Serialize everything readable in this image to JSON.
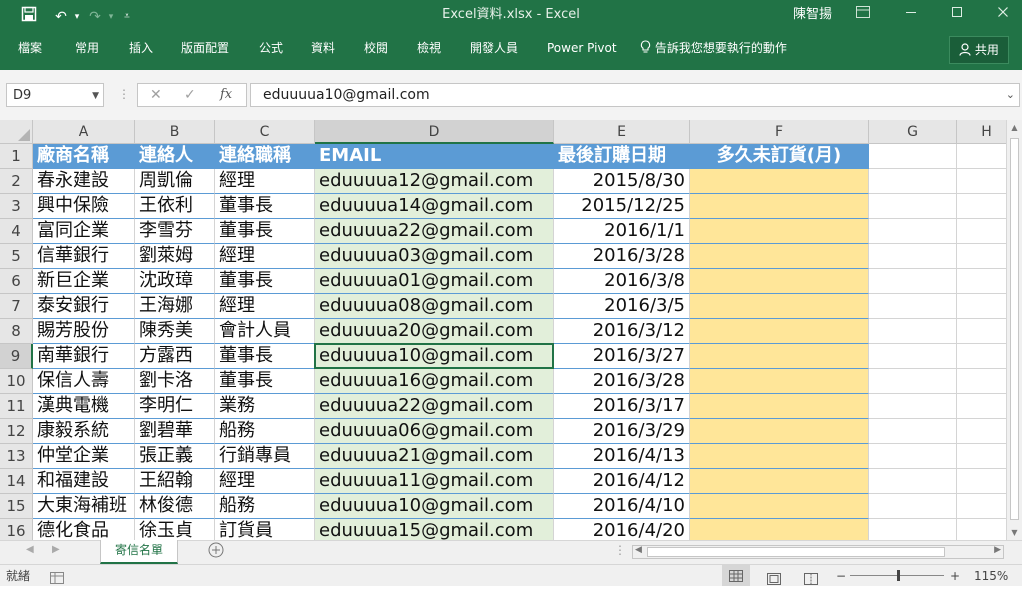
{
  "window": {
    "title": "Excel資料.xlsx - Excel",
    "user": "陳智揚"
  },
  "ribbon": {
    "tabs": [
      "檔案",
      "常用",
      "插入",
      "版面配置",
      "公式",
      "資料",
      "校閱",
      "檢視",
      "開發人員",
      "Power Pivot"
    ],
    "tell_me": "告訴我您想要執行的動作",
    "share": "共用"
  },
  "formula_bar": {
    "name_box": "D9",
    "fx": "fx",
    "value": "eduuuua10@gmail.com"
  },
  "columns": [
    "A",
    "B",
    "C",
    "D",
    "E",
    "F",
    "G",
    "H"
  ],
  "rows": [
    1,
    2,
    3,
    4,
    5,
    6,
    7,
    8,
    9,
    10,
    11,
    12,
    13,
    14,
    15,
    16
  ],
  "header_row": [
    "廠商名稱",
    "連絡人",
    "連絡職稱",
    "EMAIL",
    "最後訂購日期",
    "多久未訂貨(月)"
  ],
  "data": [
    [
      "春永建設",
      "周凱倫",
      "經理",
      "eduuuua12@gmail.com",
      "2015/8/30",
      ""
    ],
    [
      "興中保險",
      "王依利",
      "董事長",
      "eduuuua14@gmail.com",
      "2015/12/25",
      ""
    ],
    [
      "富同企業",
      "李雪芬",
      "董事長",
      "eduuuua22@gmail.com",
      "2016/1/1",
      ""
    ],
    [
      "信華銀行",
      "劉萊姆",
      "經理",
      "eduuuua03@gmail.com",
      "2016/3/28",
      ""
    ],
    [
      "新巨企業",
      "沈政璋",
      "董事長",
      "eduuuua01@gmail.com",
      "2016/3/8",
      ""
    ],
    [
      "泰安銀行",
      "王海娜",
      "經理",
      "eduuuua08@gmail.com",
      "2016/3/5",
      ""
    ],
    [
      "賜芳股份",
      "陳秀美",
      "會計人員",
      "eduuuua20@gmail.com",
      "2016/3/12",
      ""
    ],
    [
      "南華銀行",
      "方露西",
      "董事長",
      "eduuuua10@gmail.com",
      "2016/3/27",
      ""
    ],
    [
      "保信人壽",
      "劉卡洛",
      "董事長",
      "eduuuua16@gmail.com",
      "2016/3/28",
      ""
    ],
    [
      "漢典電機",
      "李明仁",
      "業務",
      "eduuuua22@gmail.com",
      "2016/3/17",
      ""
    ],
    [
      "康毅系統",
      "劉碧華",
      "船務",
      "eduuuua06@gmail.com",
      "2016/3/29",
      ""
    ],
    [
      "仲堂企業",
      "張正義",
      "行銷專員",
      "eduuuua21@gmail.com",
      "2016/4/13",
      ""
    ],
    [
      "和福建設",
      "王紹翰",
      "經理",
      "eduuuua11@gmail.com",
      "2016/4/12",
      ""
    ],
    [
      "大東海補班",
      "林俊德",
      "船務",
      "eduuuua10@gmail.com",
      "2016/4/10",
      ""
    ],
    [
      "德化食品",
      "徐玉貞",
      "訂貨員",
      "eduuuua15@gmail.com",
      "2016/4/20",
      ""
    ]
  ],
  "sheet_tab": "寄信名單",
  "status": {
    "ready": "就緒",
    "zoom": "115%"
  },
  "colors": {
    "excel_green": "#217346",
    "header_blue": "#5b9bd5",
    "email_fill": "#e2efda",
    "f_fill": "#ffe699"
  },
  "icons": [
    "save-icon",
    "undo-icon",
    "redo-icon",
    "customize-qat-icon",
    "lightbulb-icon",
    "person-icon",
    "add-sheet-icon"
  ]
}
